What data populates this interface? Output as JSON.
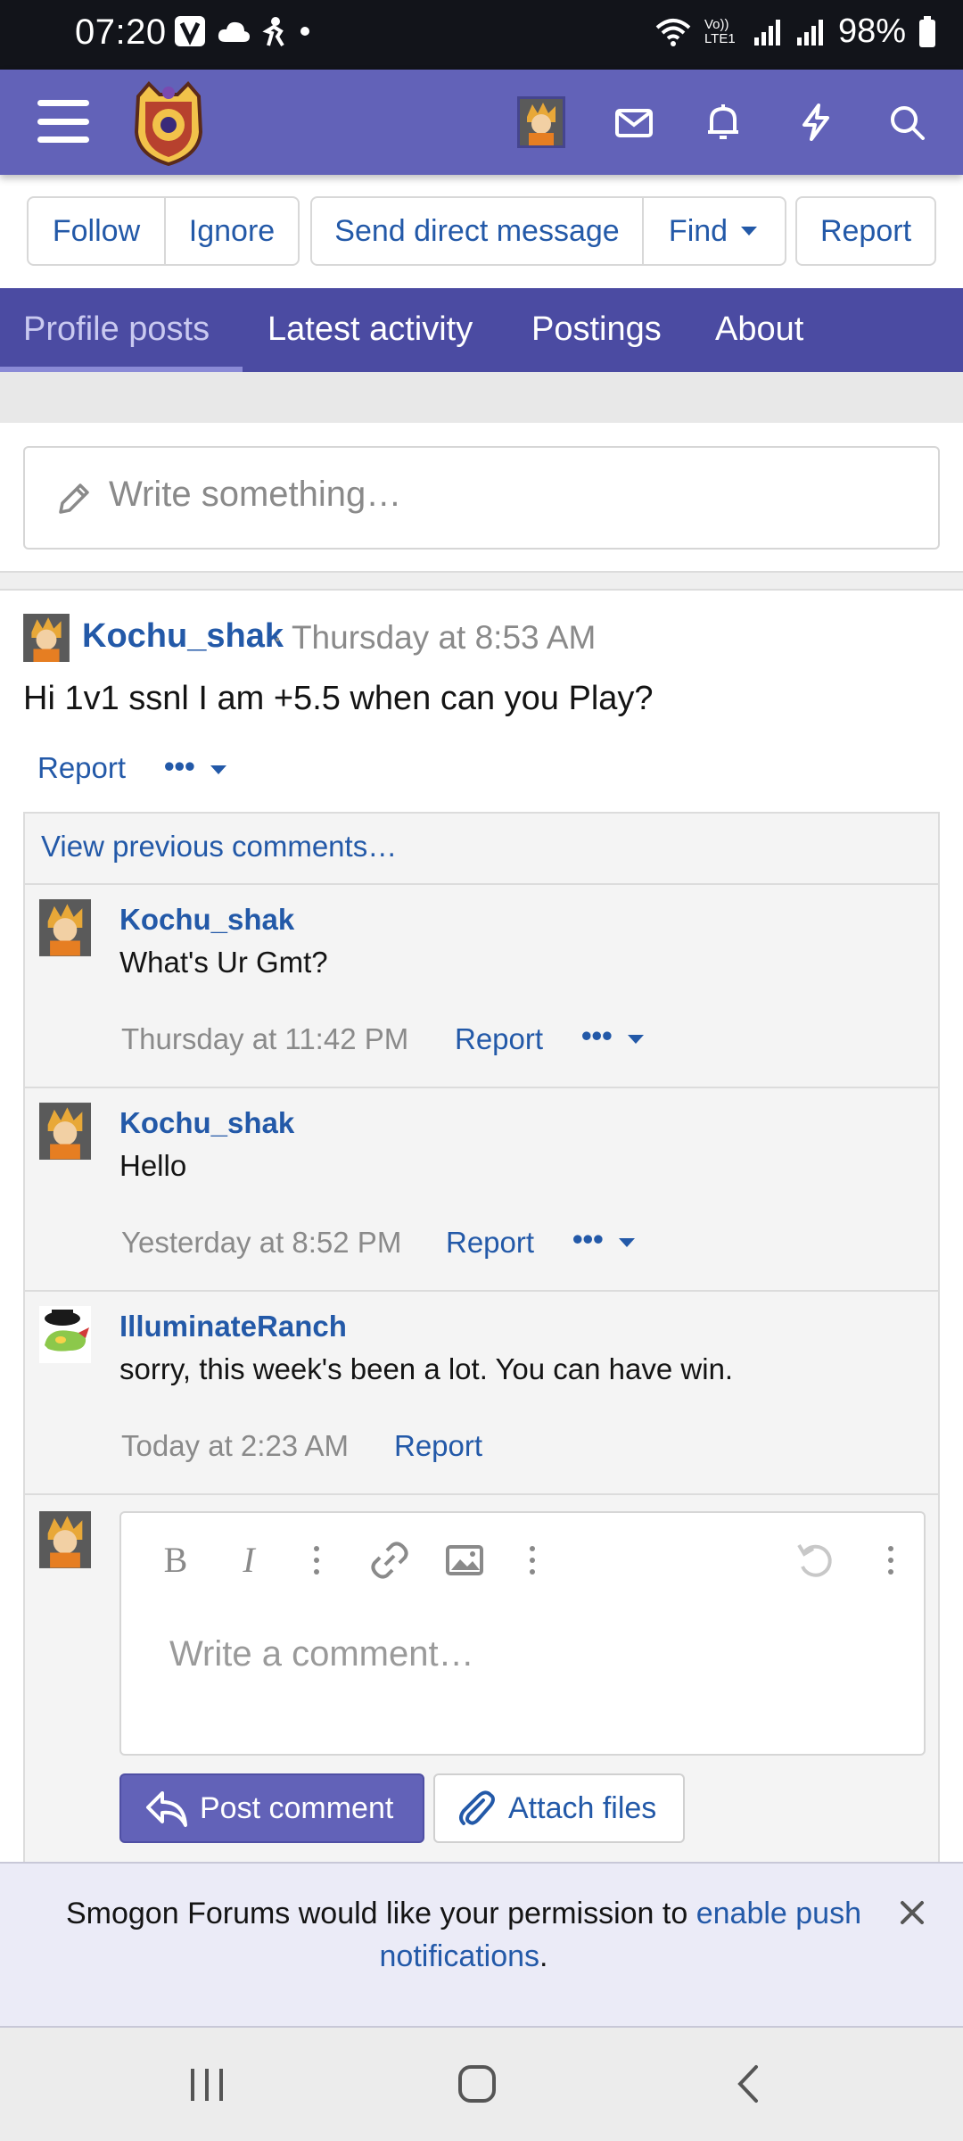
{
  "status_bar": {
    "time": "07:20",
    "battery": "98%",
    "left_icons": [
      "v-badge-icon",
      "cloud-icon",
      "figure-icon",
      "dot-icon"
    ],
    "right_icons": [
      "wifi-icon",
      "volte-icon",
      "signal-icon",
      "signal-icon",
      "battery-icon"
    ],
    "volte_label": "Vo)) LTE1"
  },
  "navbar": {
    "icons": [
      "menu-icon",
      "site-logo",
      "avatar",
      "mail-icon",
      "bell-icon",
      "bolt-icon",
      "search-icon"
    ],
    "color": "#6262b8"
  },
  "profile_actions": {
    "follow": "Follow",
    "ignore": "Ignore",
    "send_dm": "Send direct message",
    "find": "Find",
    "report": "Report"
  },
  "tabs": [
    {
      "label": "Profile posts",
      "active": true
    },
    {
      "label": "Latest activity",
      "active": false
    },
    {
      "label": "Postings",
      "active": false
    },
    {
      "label": "About",
      "active": false
    }
  ],
  "write_box": {
    "placeholder": "Write something…"
  },
  "post": {
    "user": "Kochu_shak",
    "separator": "·",
    "time": "Thursday at 8:53 AM",
    "text": "Hi 1v1 ssnl I am +5.5 when can you Play?",
    "report": "Report",
    "more": "•••"
  },
  "comments": {
    "view_previous": "View previous comments…",
    "items": [
      {
        "user": "Kochu_shak",
        "text": "What's Ur Gmt?",
        "time": "Thursday at 11:42 PM",
        "report": "Report",
        "more": "•••"
      },
      {
        "user": "Kochu_shak",
        "text": "Hello",
        "time": "Yesterday at 8:52 PM",
        "report": "Report",
        "more": "•••"
      },
      {
        "user": "IlluminateRanch",
        "text": "sorry, this week's been a lot. You can have win.",
        "time": "Today at 2:23 AM",
        "report": "Report"
      }
    ]
  },
  "reply": {
    "placeholder": "Write a comment…",
    "toolbar_icons": [
      "bold-icon",
      "italic-icon",
      "more-vertical-icon",
      "link-icon",
      "image-icon",
      "more-vertical-icon",
      "undo-icon",
      "more-vertical-icon"
    ],
    "post_comment": "Post comment",
    "attach_files": "Attach files"
  },
  "notification": {
    "text_before": "Smogon Forums would like your permission to ",
    "link": "enable push notifications",
    "text_after": "."
  },
  "system_nav": {
    "icons": [
      "recents-icon",
      "home-icon",
      "back-icon"
    ]
  }
}
